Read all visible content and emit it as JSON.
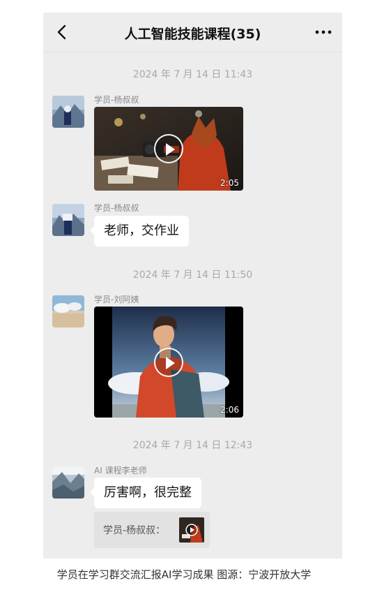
{
  "header": {
    "title": "人工智能技能课程(35)",
    "back_icon": "chevron-left-icon",
    "more_icon": "more-dots-icon"
  },
  "messages": [
    {
      "timestamp": "2024 年 7 月 14 日 11:43"
    },
    {
      "sender": "学员-杨叔叔",
      "type": "video",
      "duration": "2:05"
    },
    {
      "sender": "学员-杨叔叔",
      "type": "text",
      "text": "老师，交作业"
    },
    {
      "timestamp": "2024 年 7 月 14 日 11:50"
    },
    {
      "sender": "学员-刘阿姨",
      "type": "video",
      "duration": "2:06"
    },
    {
      "timestamp": "2024 年 7 月 14 日 12:43"
    },
    {
      "sender": "AI 课程李老师",
      "type": "text",
      "text": "厉害啊，很完整"
    }
  ],
  "quote": {
    "text": "学员-杨叔叔："
  },
  "caption": "学员在学习群交流汇报AI学习成果 图源：宁波开放大学",
  "colors": {
    "chat_bg": "#ededed",
    "bubble": "#ffffff",
    "timestamp": "#a8a8a8"
  }
}
